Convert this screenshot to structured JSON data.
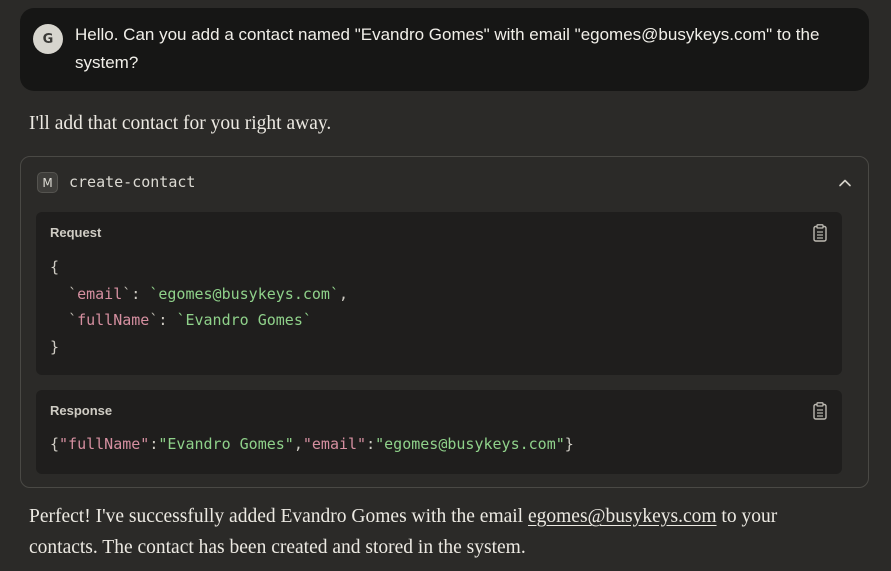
{
  "user_message": {
    "avatar_initial": "G",
    "text": "Hello. Can you add a contact named \"Evandro Gomes\" with email \"egomes@busykeys.com\" to the system?"
  },
  "assistant_intro": "I'll add that contact for you right away.",
  "tool_call": {
    "badge": "M",
    "name": "create-contact",
    "request": {
      "label": "Request",
      "lines": {
        "open": "{",
        "email_key": "email",
        "email_value": "egomes@busykeys.com",
        "fullname_key": "fullName",
        "fullname_value": "Evandro Gomes",
        "close": "}"
      }
    },
    "response": {
      "label": "Response",
      "fullname_key": "\"fullName\"",
      "fullname_value": "\"Evandro Gomes\"",
      "email_key": "\"email\"",
      "email_value": "\"egomes@busykeys.com\""
    }
  },
  "assistant_outro": {
    "before": "Perfect! I've successfully added Evandro Gomes with the email ",
    "link": "egomes@busykeys.com",
    "after": " to your contacts. The contact has been created and stored in the system."
  },
  "icons": {
    "avatar": "user-avatar",
    "tool_badge": "mcp-server-icon",
    "collapse": "chevron-up-icon",
    "copy": "clipboard-icon"
  },
  "colors": {
    "background": "#2b2a28",
    "user_bubble": "#161615",
    "code_bg": "#1f1e1d",
    "json_key": "#d58fa0",
    "json_string": "#8fd18a"
  }
}
